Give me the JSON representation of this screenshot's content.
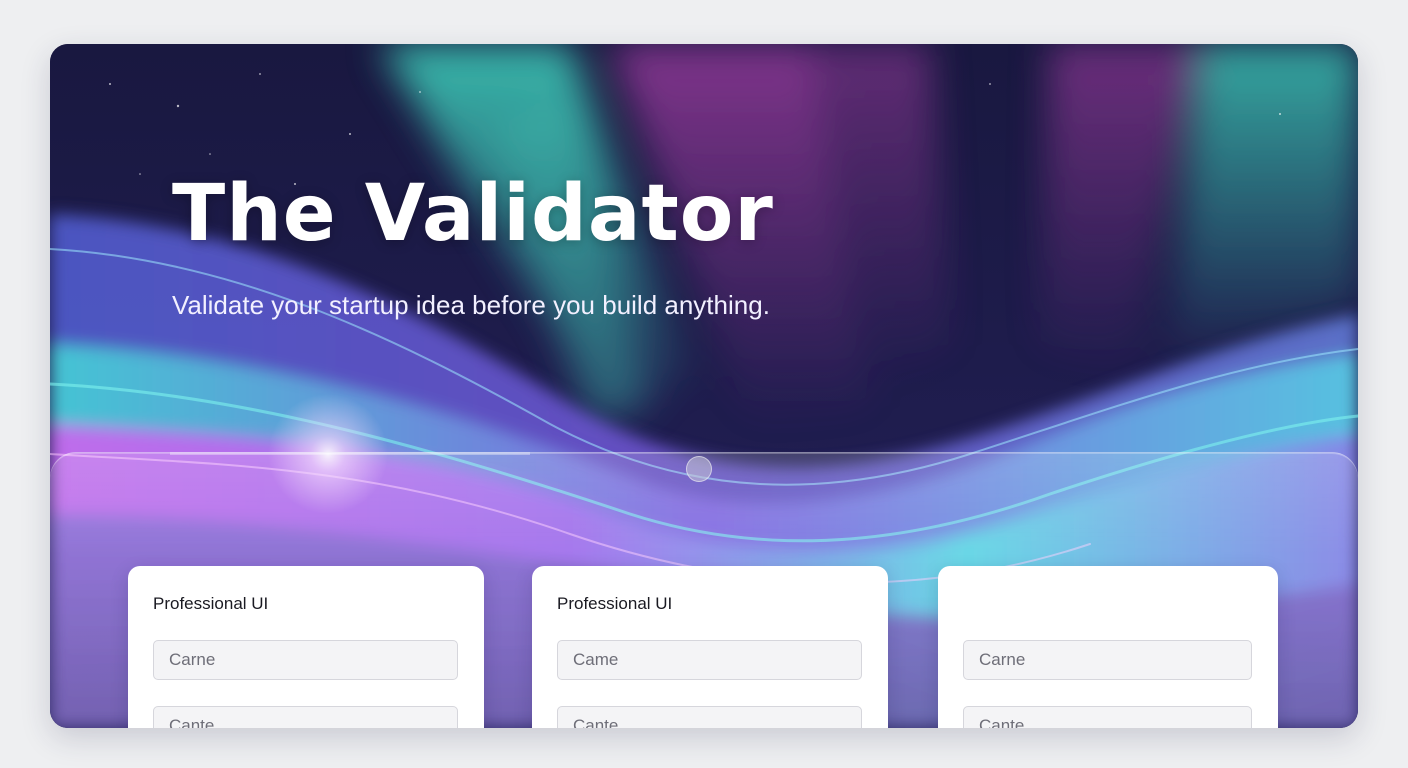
{
  "hero": {
    "title": "The Validator",
    "subtitle": "Validate your startup idea before you build anything."
  },
  "cards": [
    {
      "title": "Professional UI",
      "fields": [
        {
          "placeholder": "Carne",
          "value": ""
        },
        {
          "placeholder": "Cante",
          "value": ""
        }
      ]
    },
    {
      "title": "Professional UI",
      "fields": [
        {
          "placeholder": "Came",
          "value": ""
        },
        {
          "placeholder": "Cante",
          "value": ""
        }
      ]
    },
    {
      "title": "",
      "fields": [
        {
          "placeholder": "Carne",
          "value": ""
        },
        {
          "placeholder": "Cante",
          "value": ""
        }
      ]
    }
  ],
  "colors": {
    "background": "#eeeff1",
    "night_sky": "#1b1a43",
    "aurora_teal": "#3fd6c0",
    "aurora_purple": "#b455e0",
    "wave_blue": "#6a7ff0",
    "card_bg": "#ffffff",
    "field_bg": "#f4f4f6"
  }
}
